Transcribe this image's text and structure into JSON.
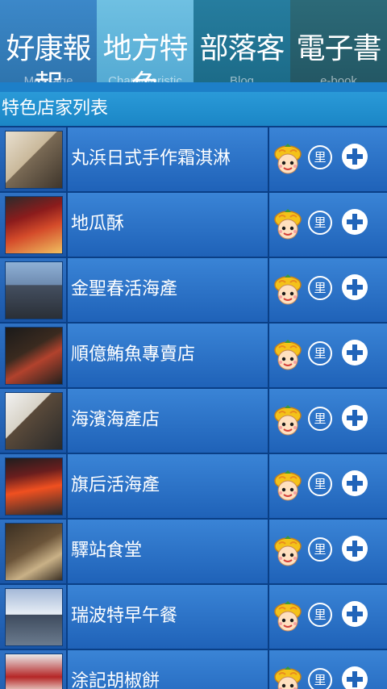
{
  "tabs": [
    {
      "title": "好康報報",
      "subtitle": "Message"
    },
    {
      "title": "地方特色",
      "subtitle": "Characteristic"
    },
    {
      "title": "部落客",
      "subtitle": "Blog"
    },
    {
      "title": "電子書",
      "subtitle": "e-book"
    }
  ],
  "section": {
    "title": "特色店家列表"
  },
  "shops": [
    {
      "name": "丸浜日式手作霜淇淋"
    },
    {
      "name": "地瓜酥"
    },
    {
      "name": "金聖春活海產"
    },
    {
      "name": "順億鮪魚專賣店"
    },
    {
      "name": "海濱海產店"
    },
    {
      "name": "旗后活海產"
    },
    {
      "name": "驛站食堂"
    },
    {
      "name": "瑞波特早午餐"
    },
    {
      "name": "涂記胡椒餅"
    }
  ],
  "row_icons": {
    "distance_label": "里",
    "mascot": "mascot-icon",
    "add": "add-icon"
  },
  "colors": {
    "background": "#0a3f86",
    "row_gradient_top": "#3a84d6",
    "row_gradient_bottom": "#1f62b8",
    "header": "#1b86c6"
  }
}
